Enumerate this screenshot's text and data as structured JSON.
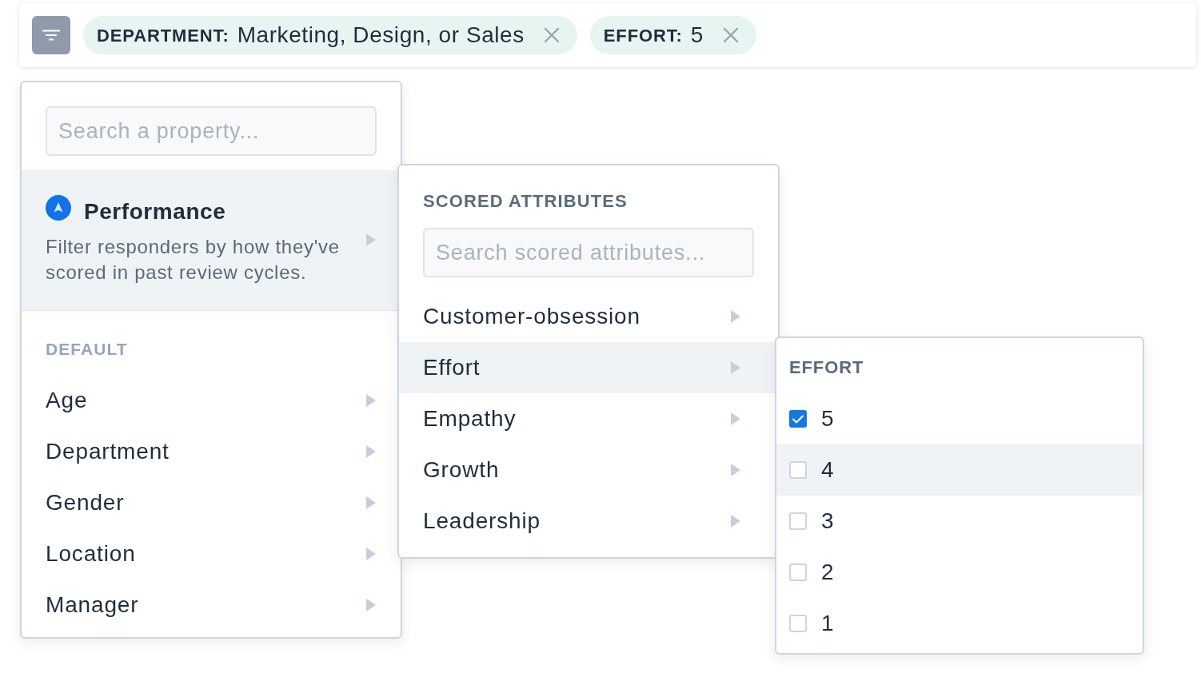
{
  "filter_bar": {
    "chips": [
      {
        "label": "DEPARTMENT:",
        "value": "Marketing, Design, or Sales"
      },
      {
        "label": "EFFORT:",
        "value": "5"
      }
    ]
  },
  "property_menu": {
    "search": {
      "placeholder": "Search a property..."
    },
    "featured": {
      "title": "Performance",
      "description": "Filter responders by how they've scored in past review cycles.",
      "selected": true
    },
    "section_heading": "DEFAULT",
    "items": [
      {
        "label": "Age",
        "selected": false
      },
      {
        "label": "Department",
        "selected": false
      },
      {
        "label": "Gender",
        "selected": false
      },
      {
        "label": "Location",
        "selected": false
      },
      {
        "label": "Manager",
        "selected": false
      }
    ]
  },
  "attributes_menu": {
    "heading": "SCORED ATTRIBUTES",
    "search": {
      "placeholder": "Search scored attributes..."
    },
    "items": [
      {
        "label": "Customer-obsession",
        "selected": false
      },
      {
        "label": "Effort",
        "selected": true
      },
      {
        "label": "Empathy",
        "selected": false
      },
      {
        "label": "Growth",
        "selected": false
      },
      {
        "label": "Leadership",
        "selected": false
      }
    ]
  },
  "effort_menu": {
    "heading": "EFFORT",
    "options": [
      {
        "label": "5",
        "checked": true,
        "highlighted": false
      },
      {
        "label": "4",
        "checked": false,
        "highlighted": true
      },
      {
        "label": "3",
        "checked": false,
        "highlighted": false
      },
      {
        "label": "2",
        "checked": false,
        "highlighted": false
      },
      {
        "label": "1",
        "checked": false,
        "highlighted": false
      }
    ]
  }
}
